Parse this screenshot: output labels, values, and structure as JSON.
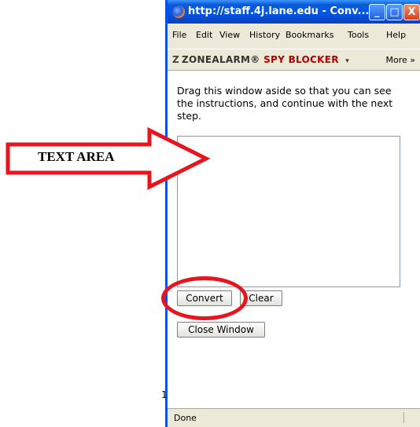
{
  "window": {
    "title": "http://staff.4j.lane.edu - Conv...",
    "buttons": {
      "minimize": "_",
      "maximize": "□",
      "close": "X"
    }
  },
  "menu": [
    "File",
    "Edit",
    "View",
    "History",
    "Bookmarks",
    "Tools",
    "Help"
  ],
  "toolbar": {
    "brand_zone": "ZONEALARM",
    "brand_reg": "®",
    "brand_spy": "SPY BLOCKER",
    "brand_caret": "▾",
    "more_label": "More",
    "more_icon": "»"
  },
  "content": {
    "instructions": "Drag this window aside so that you can see the instructions, and continue with the next step.",
    "textarea_value": "",
    "convert_label": "Convert",
    "clear_label": "Clear",
    "close_window_label": "Close Window"
  },
  "status": {
    "text": "Done"
  },
  "annotations": {
    "arrow_label": "TEXT AREA",
    "side_digit": "1"
  },
  "colors": {
    "arrow_stroke": "#e8141e",
    "highlight_oval": "#e8141e",
    "titlebar": "#0055e5"
  }
}
